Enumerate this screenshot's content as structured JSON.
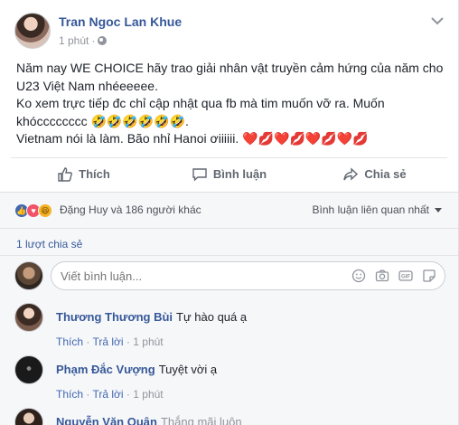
{
  "post": {
    "author": "Tran Ngoc Lan Khue",
    "time": "1 phút",
    "lines": [
      "Năm nay WE CHOICE hãy trao giải nhân vật truyền cảm hứng của năm cho",
      "U23 Việt Nam nhéeeeee.",
      "Ko xem trực tiếp đc chỉ cập nhật qua fb mà tim muốn vỡ ra. Muốn",
      "khócccccccc 🤣🤣🤣🤣🤣🤣.",
      "Vietnam nói là làm. Bão nhỉ Hanoi ơiiiiii. ❤️💋❤️💋❤️💋❤️💋"
    ]
  },
  "actions": {
    "like": "Thích",
    "comment": "Bình luận",
    "share": "Chia sẻ"
  },
  "reactions": {
    "text": "Đặng Huy và 186 người khác",
    "relevance": "Bình luận liên quan nhất"
  },
  "shares": "1 lượt chia sẻ",
  "comment_input": {
    "placeholder": "Viết bình luận..."
  },
  "comments": [
    {
      "name": "Thương Thương Bùi",
      "text": "Tự hào quá ạ",
      "like": "Thích",
      "reply": "Trả lời",
      "time": "1 phút"
    },
    {
      "name": "Phạm Đắc Vượng",
      "text": "Tuyệt vời ạ",
      "like": "Thích",
      "reply": "Trả lời",
      "time": "1 phút"
    },
    {
      "name": "Nguyễn Văn Quân",
      "text": "Thắng mãi luôn"
    }
  ],
  "colors": {
    "link": "#365899",
    "like_react": "#4267b2",
    "love_react": "#f25268",
    "haha_react": "#f7b125"
  }
}
